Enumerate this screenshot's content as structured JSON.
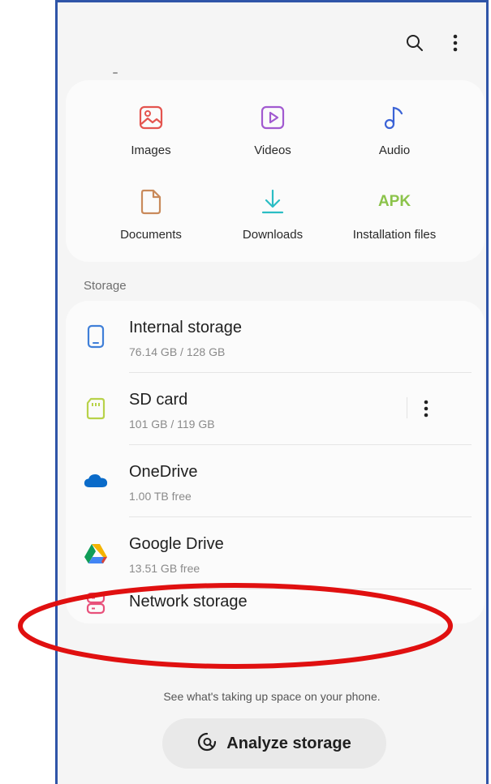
{
  "categories": [
    {
      "label": "Images",
      "icon": "image-icon",
      "color": "#e4544f"
    },
    {
      "label": "Videos",
      "icon": "video-icon",
      "color": "#a15ad0"
    },
    {
      "label": "Audio",
      "icon": "music-note-icon",
      "color": "#3b63d6"
    },
    {
      "label": "Documents",
      "icon": "document-icon",
      "color": "#c98a5b"
    },
    {
      "label": "Downloads",
      "icon": "download-icon",
      "color": "#2bbdc4"
    },
    {
      "label": "Installation files",
      "icon": "apk-icon",
      "icon_text": "APK",
      "color": "#8bc34a"
    }
  ],
  "storage": {
    "section_label": "Storage",
    "items": [
      {
        "title": "Internal storage",
        "subtitle": "76.14 GB / 128 GB",
        "icon": "phone-icon",
        "color": "#3f7fd8"
      },
      {
        "title": "SD card",
        "subtitle": "101 GB / 119 GB",
        "icon": "sd-card-icon",
        "color": "#b8d24a"
      },
      {
        "title": "OneDrive",
        "subtitle": "1.00 TB free",
        "icon": "onedrive-icon",
        "color": "#0a6bc9"
      },
      {
        "title": "Google Drive",
        "subtitle": "13.51 GB free",
        "icon": "google-drive-icon"
      },
      {
        "title": "Network storage",
        "subtitle": "",
        "icon": "network-storage-icon",
        "color": "#e8507a"
      }
    ]
  },
  "hint": "See what's taking up space on your phone.",
  "analyze_button_label": "Analyze storage",
  "highlight_color": "#e01010"
}
